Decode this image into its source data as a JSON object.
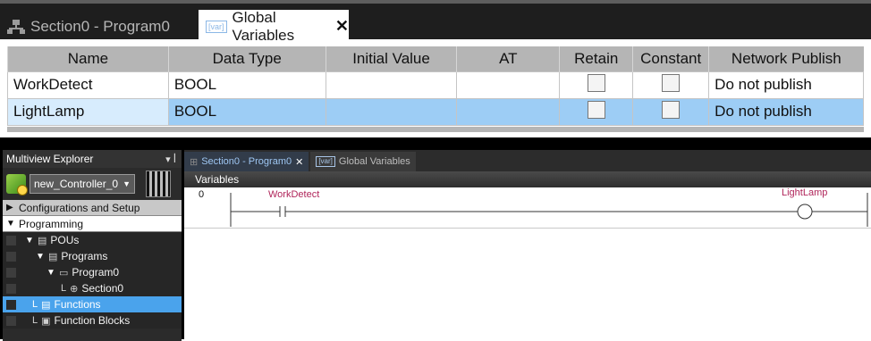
{
  "top_panel": {
    "tabs": [
      {
        "label": "Section0 - Program0",
        "icon": "network-icon",
        "active": false
      },
      {
        "label": "Global Variables",
        "icon": "var-icon",
        "icon_text": "[var]",
        "active": true,
        "close": "✕"
      }
    ],
    "table": {
      "columns": [
        "Name",
        "Data Type",
        "Initial Value",
        "AT",
        "Retain",
        "Constant",
        "Network Publish"
      ],
      "rows": [
        {
          "name": "WorkDetect",
          "data_type": "BOOL",
          "initial_value": "",
          "at": "",
          "retain": false,
          "constant": false,
          "network_publish": "Do not publish",
          "selected": false
        },
        {
          "name": "LightLamp",
          "data_type": "BOOL",
          "initial_value": "",
          "at": "",
          "retain": false,
          "constant": false,
          "network_publish": "Do not publish",
          "selected": true
        }
      ]
    }
  },
  "explorer": {
    "title": "Multiview Explorer",
    "pin_glyph": "▾ ꟾ",
    "controller": {
      "value": "new_Controller_0",
      "arrow": "▼"
    },
    "sections": {
      "config": {
        "label": "Configurations and Setup",
        "arrow": "▶"
      },
      "programming": {
        "label": "Programming",
        "arrow": "▼"
      }
    },
    "tree": {
      "pous": {
        "label": "POUs",
        "arrow": "▼",
        "icon": "▤"
      },
      "programs": {
        "label": "Programs",
        "arrow": "▼",
        "icon": "▤"
      },
      "program0": {
        "label": "Program0",
        "arrow": "▼",
        "icon": "▭"
      },
      "section0": {
        "label": "Section0",
        "prefix": "L",
        "icon": "⊕"
      },
      "functions": {
        "label": "Functions",
        "prefix": "L",
        "icon": "▤",
        "selected": true
      },
      "function_blocks": {
        "label": "Function Blocks",
        "prefix": "L",
        "icon": "▣"
      }
    }
  },
  "editor": {
    "tabs": [
      {
        "label": "Section0 - Program0",
        "close": "✕",
        "active": true
      },
      {
        "label": "Global Variables",
        "icon_text": "[var]",
        "active": false
      }
    ],
    "variables_bar": "Variables",
    "rung": {
      "number": "0",
      "contact_variable": "WorkDetect",
      "coil_variable": "LightLamp"
    }
  },
  "colors": {
    "selection_blue": "#4aa3ec",
    "row_selected": "#9dcdf5",
    "variable_label": "#b0255a",
    "header_gray": "#b5b5b5"
  }
}
